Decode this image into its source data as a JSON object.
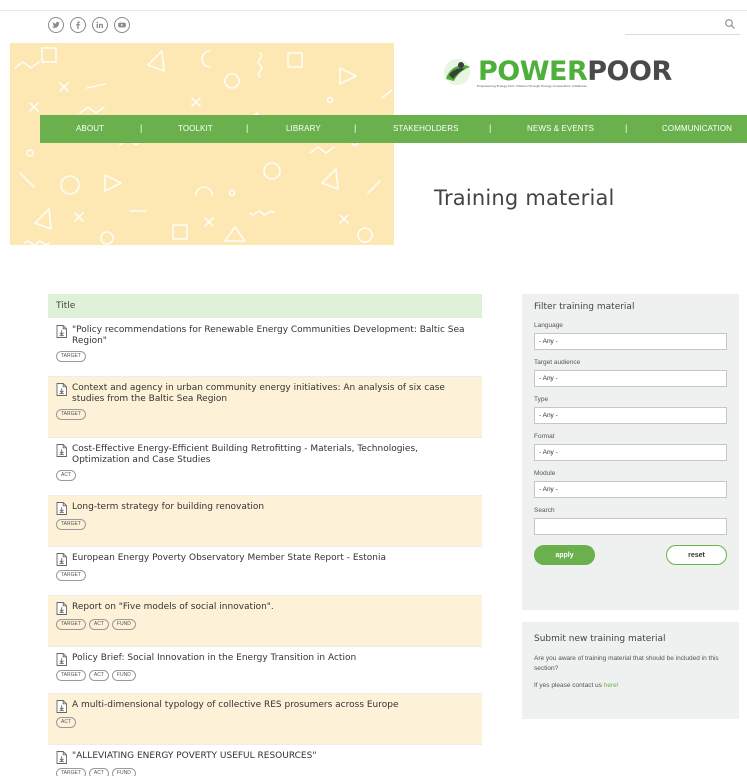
{
  "social": {
    "icons": [
      "twitter-icon",
      "facebook-icon",
      "linkedin-icon",
      "youtube-icon"
    ]
  },
  "logo": {
    "text_a": "POWER",
    "text_b": "POOR",
    "tagline": "Empowering Energy Poor Citizens through Energy Cooperation Initiatives"
  },
  "nav": {
    "items": [
      "ABOUT",
      "TOOLKIT",
      "LIBRARY",
      "STAKEHOLDERS",
      "NEWS & EVENTS",
      "COMMUNICATION"
    ],
    "separator": "|"
  },
  "page": {
    "title": "Training material"
  },
  "table": {
    "header": "Title",
    "rows": [
      {
        "title": "\"Policy recommendations for Renewable Energy Communities Development: Baltic Sea Region\"",
        "tags": [
          "TARGET"
        ]
      },
      {
        "title": "Context and agency in urban community energy initiatives: An analysis of six case studies from the Baltic Sea Region",
        "tags": [
          "TARGET"
        ]
      },
      {
        "title": "Cost-Effective Energy-Efficient Building Retrofitting - Materials, Technologies, Optimization and Case Studies",
        "tags": [
          "ACT"
        ]
      },
      {
        "title": "Long-term strategy for building renovation",
        "tags": [
          "TARGET"
        ]
      },
      {
        "title": "European Energy Poverty Observatory Member State Report - Estonia",
        "tags": [
          "TARGET"
        ]
      },
      {
        "title": "Report on \"Five models of social innovation\".",
        "tags": [
          "TARGET",
          "ACT",
          "FUND"
        ]
      },
      {
        "title": "Policy Brief: Social Innovation in the Energy Transition in Action",
        "tags": [
          "TARGET",
          "ACT",
          "FUND"
        ]
      },
      {
        "title": "A multi-dimensional typology of collective RES prosumers across Europe",
        "tags": [
          "ACT"
        ]
      },
      {
        "title": "\"ALLEVIATING ENERGY POVERTY USEFUL RESOURCES\"",
        "tags": [
          "TARGET",
          "ACT",
          "FUND"
        ]
      }
    ]
  },
  "filter": {
    "title": "Filter training material",
    "language_label": "Language",
    "language_value": "- Any -",
    "audience_label": "Target audience",
    "audience_value": "- Any -",
    "type_label": "Type",
    "type_value": "- Any -",
    "format_label": "Format",
    "format_value": "- Any -",
    "module_label": "Module",
    "module_value": "- Any -",
    "search_label": "Search",
    "apply_label": "apply",
    "reset_label": "reset"
  },
  "submit": {
    "title": "Submit new training material",
    "text": "Are you aware of training material that should be included in this section?",
    "contact_prefix": "If yes please contact us ",
    "contact_link": "here!"
  },
  "colors": {
    "green": "#6ab04c",
    "light_green": "#dff0d8",
    "cream": "#fdf1d8",
    "yellow_pattern": "#fde8b3"
  }
}
